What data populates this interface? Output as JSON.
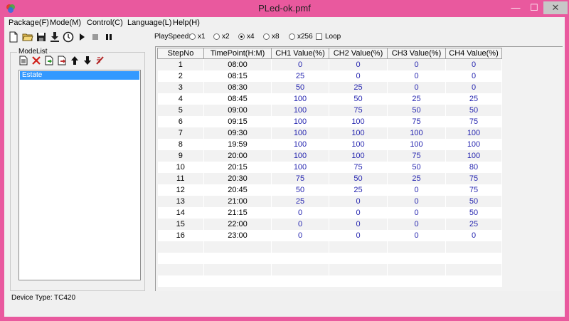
{
  "window": {
    "title": "PLed-ok.pmf",
    "controls": {
      "min": "—",
      "max": "☐",
      "close": "✕"
    }
  },
  "menu": [
    {
      "label": "Package(F)"
    },
    {
      "label": "Mode(M)"
    },
    {
      "label": "Control(C)"
    },
    {
      "label": "Language(L)"
    },
    {
      "label": "Help(H)"
    }
  ],
  "toolbar": {
    "icons": [
      "new-file-icon",
      "open-folder-icon",
      "save-icon",
      "download-icon",
      "clock-icon",
      "play-icon",
      "stop-icon",
      "pause-icon"
    ]
  },
  "playspeed": {
    "label": "PlaySpeed:",
    "options": [
      {
        "label": "x1",
        "checked": false
      },
      {
        "label": "x2",
        "checked": false
      },
      {
        "label": "x4",
        "checked": true
      },
      {
        "label": "x8",
        "checked": false
      },
      {
        "label": "x256",
        "checked": false
      }
    ],
    "loop_label": "Loop",
    "loop_checked": false
  },
  "modelist": {
    "label": "ModeList",
    "tools": [
      "new-mode-icon",
      "delete-icon",
      "import-icon",
      "export-icon",
      "move-up-icon",
      "move-down-icon",
      "clear-icon"
    ],
    "items": [
      {
        "label": "Estate",
        "selected": true
      }
    ]
  },
  "table": {
    "columns": [
      "StepNo",
      "TimePoint(H:M)",
      "CH1 Value(%)",
      "CH2 Value(%)",
      "CH3 Value(%)",
      "CH4 Value(%)"
    ],
    "rows": [
      [
        "1",
        "08:00",
        "0",
        "0",
        "0",
        "0"
      ],
      [
        "2",
        "08:15",
        "25",
        "0",
        "0",
        "0"
      ],
      [
        "3",
        "08:30",
        "50",
        "25",
        "0",
        "0"
      ],
      [
        "4",
        "08:45",
        "100",
        "50",
        "25",
        "25"
      ],
      [
        "5",
        "09:00",
        "100",
        "75",
        "50",
        "50"
      ],
      [
        "6",
        "09:15",
        "100",
        "100",
        "75",
        "75"
      ],
      [
        "7",
        "09:30",
        "100",
        "100",
        "100",
        "100"
      ],
      [
        "8",
        "19:59",
        "100",
        "100",
        "100",
        "100"
      ],
      [
        "9",
        "20:00",
        "100",
        "100",
        "75",
        "100"
      ],
      [
        "10",
        "20:15",
        "100",
        "75",
        "50",
        "80"
      ],
      [
        "11",
        "20:30",
        "75",
        "50",
        "25",
        "75"
      ],
      [
        "12",
        "20:45",
        "50",
        "25",
        "0",
        "75"
      ],
      [
        "13",
        "21:00",
        "25",
        "0",
        "0",
        "50"
      ],
      [
        "14",
        "21:15",
        "0",
        "0",
        "0",
        "50"
      ],
      [
        "15",
        "22:00",
        "0",
        "0",
        "0",
        "25"
      ],
      [
        "16",
        "23:00",
        "0",
        "0",
        "0",
        "0"
      ]
    ]
  },
  "status": {
    "label": "Device Type:",
    "value": "TC420"
  },
  "colors": {
    "window_frame": "#e9599e",
    "value_text": "#2727b0",
    "selection": "#3399ff"
  }
}
